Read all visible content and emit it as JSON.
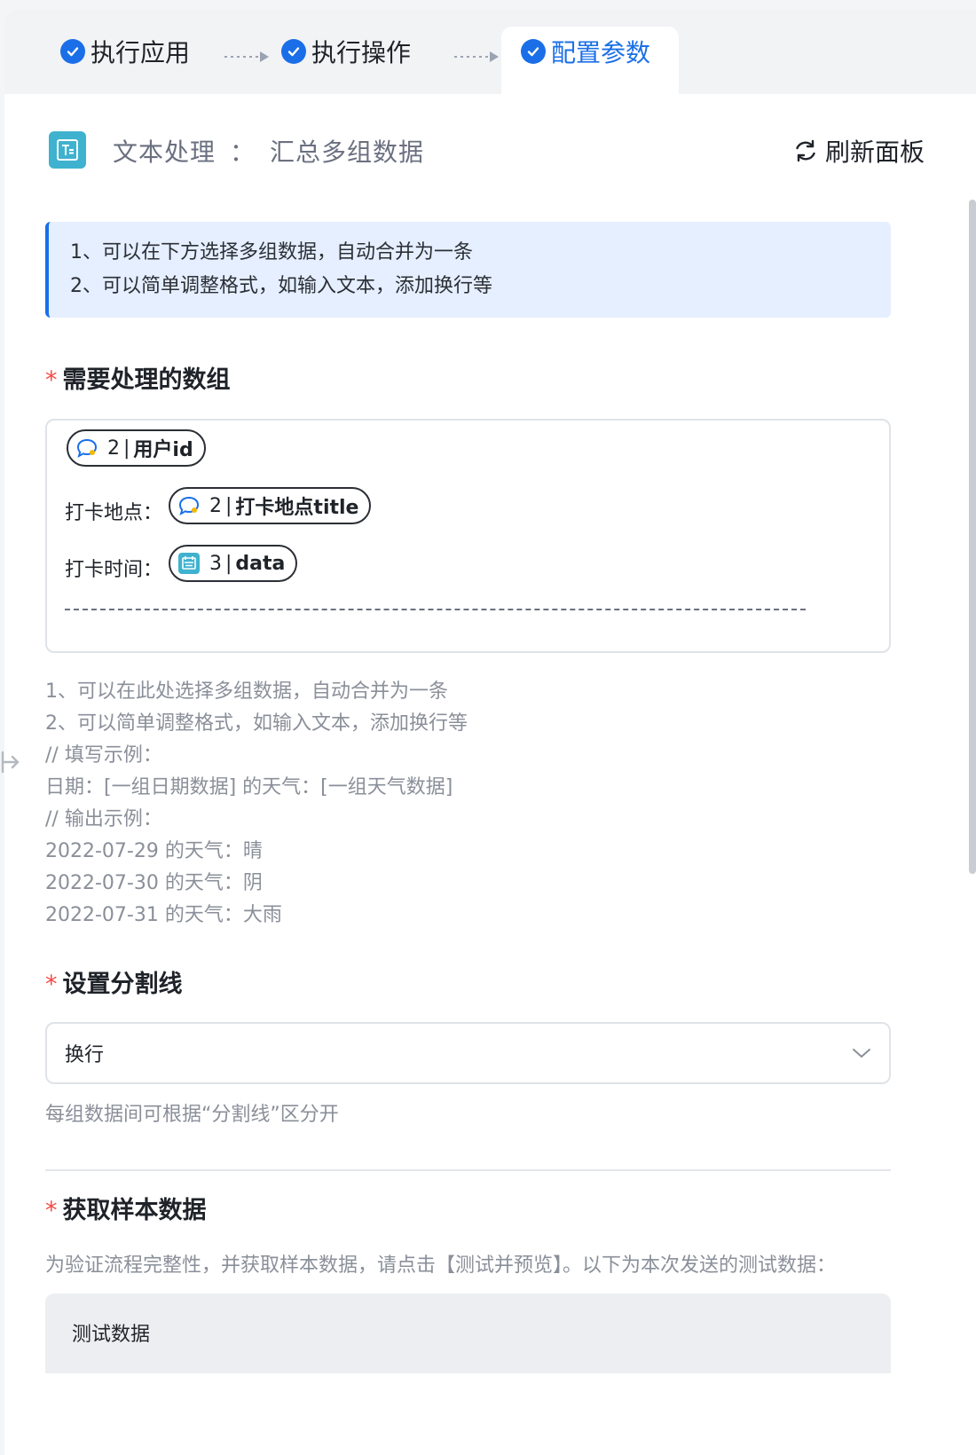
{
  "steps": [
    {
      "label": "执行应用"
    },
    {
      "label": "执行操作"
    },
    {
      "label": "配置参数"
    }
  ],
  "header": {
    "app_name": "文本处理",
    "separator": "：",
    "action_name": "汇总多组数据",
    "refresh_label": "刷新面板"
  },
  "info": {
    "lines": [
      "1、可以在下方选择多组数据，自动合并为一条",
      "2、可以简单调整格式，如输入文本，添加换行等"
    ]
  },
  "array_field": {
    "label": "需要处理的数组",
    "required_mark": "*",
    "chips": [
      {
        "num": "2",
        "sep": "|",
        "name": "用户id",
        "icon": "chat-bubble-icon"
      },
      {
        "num": "2",
        "sep": "|",
        "name": "打卡地点title",
        "icon": "chat-bubble-icon"
      },
      {
        "num": "3",
        "sep": "|",
        "name": "data",
        "icon": "calendar-icon"
      }
    ],
    "line_labels": [
      "打卡地点：",
      "打卡时间："
    ],
    "help_lines": [
      "1、可以在此处选择多组数据，自动合并为一条",
      "2、可以简单调整格式，如输入文本，添加换行等",
      "// 填写示例：",
      "日期：[一组日期数据] 的天气：[一组天气数据]",
      "// 输出示例：",
      "2022-07-29 的天气：晴",
      "2022-07-30 的天气：阴",
      "2022-07-31 的天气：大雨"
    ]
  },
  "separator_field": {
    "label": "设置分割线",
    "required_mark": "*",
    "value": "换行",
    "hint": "每组数据间可根据“分割线”区分开"
  },
  "sample_field": {
    "label": "获取样本数据",
    "required_mark": "*",
    "hint": "为验证流程完整性，并获取样本数据，请点击【测试并预览】。以下为本次发送的测试数据：",
    "test_box_label": "测试数据"
  },
  "colors": {
    "accent": "#1a6fe8",
    "required": "#f54a45",
    "app_icon": "#3fb2cf"
  }
}
